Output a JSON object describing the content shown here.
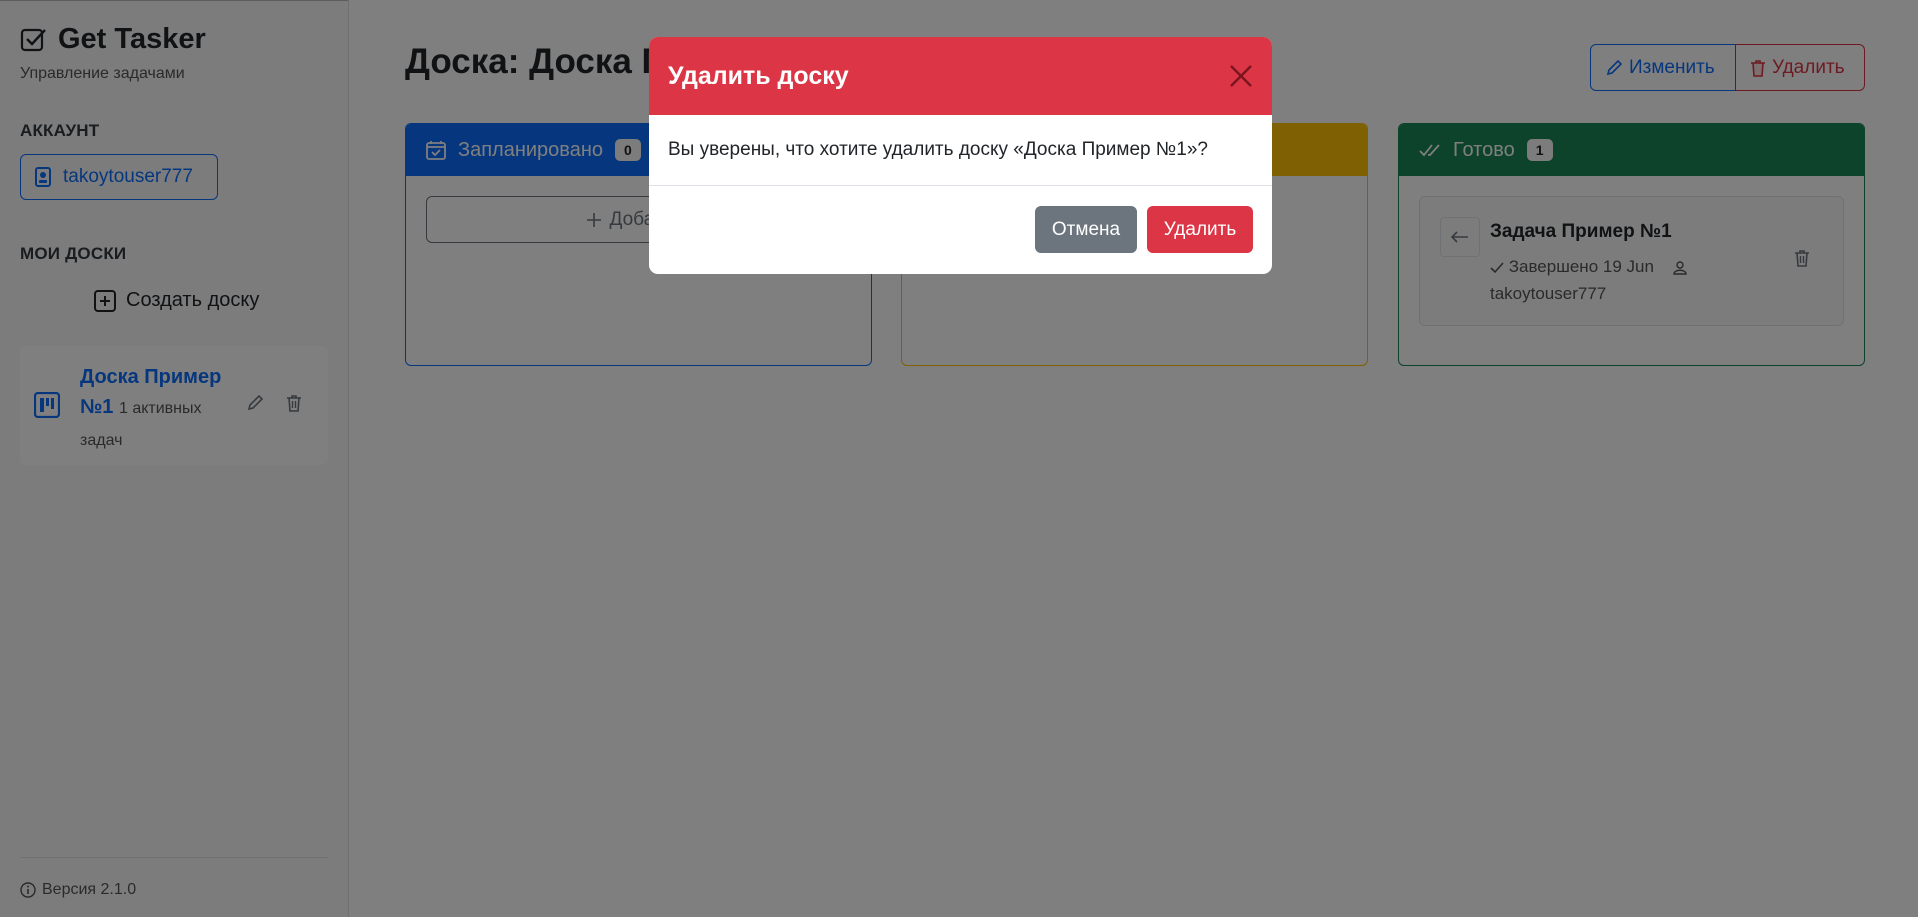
{
  "sidebar": {
    "brand_title": "Get Tasker",
    "brand_subtitle": "Управление задачами",
    "account_label": "АККАУНТ",
    "username": "takoytouser777",
    "boards_label": "МОИ ДОСКИ",
    "create_board": "Создать доску",
    "boards": [
      {
        "name": "Доска Пример №1",
        "meta": "1 активных задач"
      }
    ],
    "version": "Версия 2.1.0"
  },
  "main": {
    "title": "Доска: Доска Пример №1",
    "edit_label": "Изменить",
    "delete_label": "Удалить",
    "columns": [
      {
        "name": "Запланировано",
        "count": "0",
        "add_label": "Добавить"
      },
      {
        "name": "",
        "count": ""
      },
      {
        "name": "Готово",
        "count": "1"
      }
    ],
    "task": {
      "title": "Задача Пример №1",
      "status": "Завершено 19 Jun",
      "assignee": "takoytouser777"
    }
  },
  "modal": {
    "title": "Удалить доску",
    "message": "Вы уверены, что хотите удалить доску «Доска Пример №1»?",
    "cancel_label": "Отмена",
    "confirm_label": "Удалить"
  },
  "colors": {
    "primary": "#0d6efd",
    "warning": "#ffc107",
    "success": "#198754",
    "danger": "#dc3545",
    "secondary": "#6c757d"
  }
}
